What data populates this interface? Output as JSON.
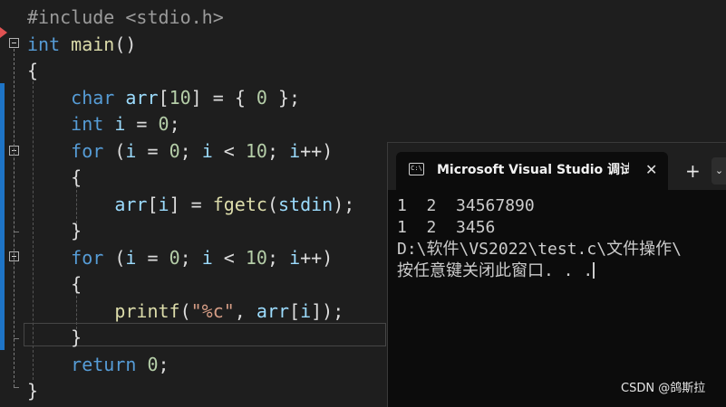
{
  "editor": {
    "lines": [
      [
        {
          "t": "#include <stdio.h>",
          "c": "pre"
        }
      ],
      [
        {
          "t": "int",
          "c": "kw"
        },
        {
          "t": " ",
          "c": "plain"
        },
        {
          "t": "main",
          "c": "fn"
        },
        {
          "t": "()",
          "c": "plain"
        }
      ],
      [
        {
          "t": "{",
          "c": "plain"
        }
      ],
      [
        {
          "t": "    ",
          "c": "plain"
        },
        {
          "t": "char",
          "c": "kw"
        },
        {
          "t": " ",
          "c": "plain"
        },
        {
          "t": "arr",
          "c": "var"
        },
        {
          "t": "[",
          "c": "plain"
        },
        {
          "t": "10",
          "c": "num"
        },
        {
          "t": "] = { ",
          "c": "plain"
        },
        {
          "t": "0",
          "c": "num"
        },
        {
          "t": " };",
          "c": "plain"
        }
      ],
      [
        {
          "t": "    ",
          "c": "plain"
        },
        {
          "t": "int",
          "c": "kw"
        },
        {
          "t": " ",
          "c": "plain"
        },
        {
          "t": "i",
          "c": "var"
        },
        {
          "t": " = ",
          "c": "plain"
        },
        {
          "t": "0",
          "c": "num"
        },
        {
          "t": ";",
          "c": "plain"
        }
      ],
      [
        {
          "t": "    ",
          "c": "plain"
        },
        {
          "t": "for",
          "c": "kw"
        },
        {
          "t": " (",
          "c": "plain"
        },
        {
          "t": "i",
          "c": "var"
        },
        {
          "t": " = ",
          "c": "plain"
        },
        {
          "t": "0",
          "c": "num"
        },
        {
          "t": "; ",
          "c": "plain"
        },
        {
          "t": "i",
          "c": "var"
        },
        {
          "t": " < ",
          "c": "plain"
        },
        {
          "t": "10",
          "c": "num"
        },
        {
          "t": "; ",
          "c": "plain"
        },
        {
          "t": "i",
          "c": "var"
        },
        {
          "t": "++)",
          "c": "plain"
        }
      ],
      [
        {
          "t": "    {",
          "c": "plain"
        }
      ],
      [
        {
          "t": "        ",
          "c": "plain"
        },
        {
          "t": "arr",
          "c": "var"
        },
        {
          "t": "[",
          "c": "plain"
        },
        {
          "t": "i",
          "c": "var"
        },
        {
          "t": "] = ",
          "c": "plain"
        },
        {
          "t": "fgetc",
          "c": "fn"
        },
        {
          "t": "(",
          "c": "plain"
        },
        {
          "t": "stdin",
          "c": "var"
        },
        {
          "t": ");",
          "c": "plain"
        }
      ],
      [
        {
          "t": "    }",
          "c": "plain"
        }
      ],
      [
        {
          "t": "    ",
          "c": "plain"
        },
        {
          "t": "for",
          "c": "kw"
        },
        {
          "t": " (",
          "c": "plain"
        },
        {
          "t": "i",
          "c": "var"
        },
        {
          "t": " = ",
          "c": "plain"
        },
        {
          "t": "0",
          "c": "num"
        },
        {
          "t": "; ",
          "c": "plain"
        },
        {
          "t": "i",
          "c": "var"
        },
        {
          "t": " < ",
          "c": "plain"
        },
        {
          "t": "10",
          "c": "num"
        },
        {
          "t": "; ",
          "c": "plain"
        },
        {
          "t": "i",
          "c": "var"
        },
        {
          "t": "++)",
          "c": "plain"
        }
      ],
      [
        {
          "t": "    {",
          "c": "plain"
        }
      ],
      [
        {
          "t": "        ",
          "c": "plain"
        },
        {
          "t": "printf",
          "c": "fn"
        },
        {
          "t": "(",
          "c": "plain"
        },
        {
          "t": "\"%c\"",
          "c": "str"
        },
        {
          "t": ", ",
          "c": "plain"
        },
        {
          "t": "arr",
          "c": "var"
        },
        {
          "t": "[",
          "c": "plain"
        },
        {
          "t": "i",
          "c": "var"
        },
        {
          "t": "]);",
          "c": "plain"
        }
      ],
      [
        {
          "t": "    }",
          "c": "plain"
        }
      ],
      [
        {
          "t": "    ",
          "c": "plain"
        },
        {
          "t": "return",
          "c": "kw"
        },
        {
          "t": " ",
          "c": "plain"
        },
        {
          "t": "0",
          "c": "num"
        },
        {
          "t": ";",
          "c": "plain"
        }
      ],
      [
        {
          "t": "}",
          "c": "plain"
        }
      ]
    ]
  },
  "console": {
    "title": "Microsoft Visual Studio 调试控制台",
    "icon_text": "C:\\",
    "close_glyph": "✕",
    "new_tab_glyph": "+",
    "dropdown_glyph": "⌄",
    "output": [
      "1  2  34567890",
      "1  2  3456",
      "D:\\软件\\VS2022\\test.c\\文件操作\\",
      "按任意键关闭此窗口. . ."
    ]
  },
  "watermark": "CSDN @鸽斯拉",
  "colors": {
    "editor_bg": "#1e1e1e",
    "keyword": "#569cd6",
    "function": "#dcdcaa",
    "number": "#b5cea8",
    "preprocessor": "#9b9b9b",
    "string": "#d69d85",
    "variable": "#9cdcfe",
    "console_bg": "#0c0c0c",
    "change_bar": "#1e74c6"
  }
}
